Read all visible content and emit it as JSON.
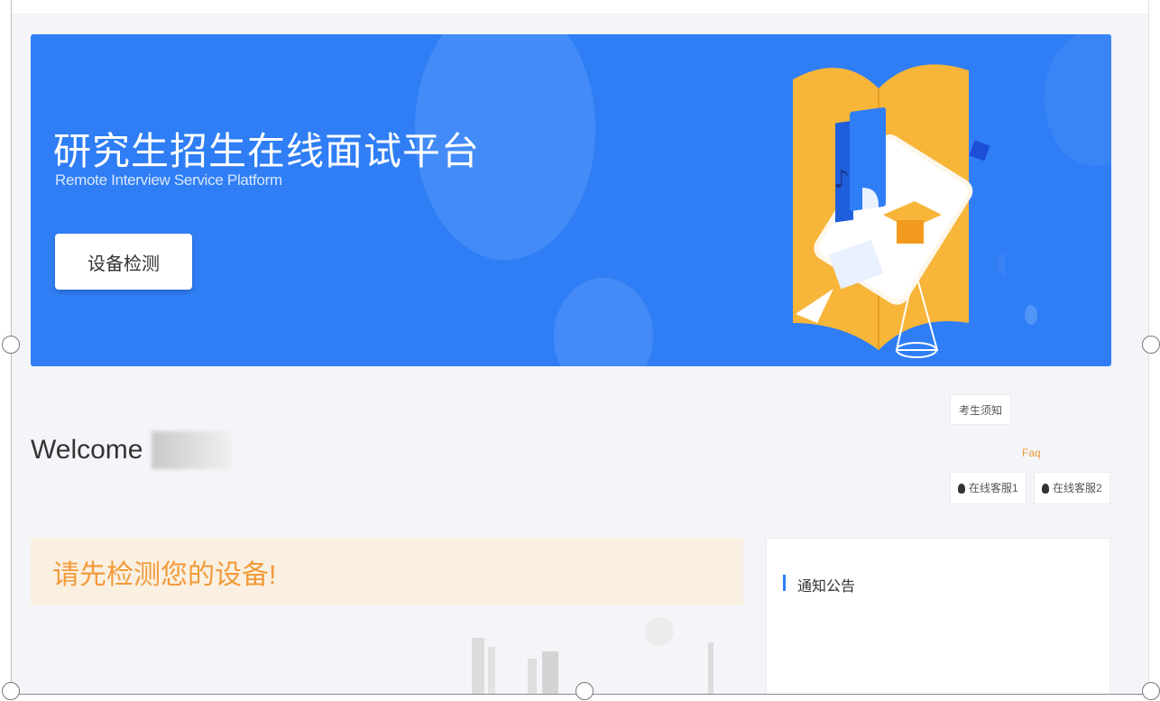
{
  "banner": {
    "title": "研究生招生在线面试平台",
    "subtitle": "Remote Interview Service Platform",
    "device_check_label": "设备检测"
  },
  "welcome": {
    "greeting": "Welcome"
  },
  "links": {
    "notice_label": "考生须知",
    "faq_label": "Faq",
    "customer_service_1": "在线客服1",
    "customer_service_2": "在线客服2"
  },
  "alert": {
    "message": "请先检测您的设备!"
  },
  "notice_panel": {
    "title": "通知公告"
  },
  "colors": {
    "banner_blue": "#2f7ef5",
    "accent_orange": "#f29a3a",
    "alert_bg": "#faf0e1"
  },
  "icons": {
    "customer_service": "qq-icon"
  }
}
